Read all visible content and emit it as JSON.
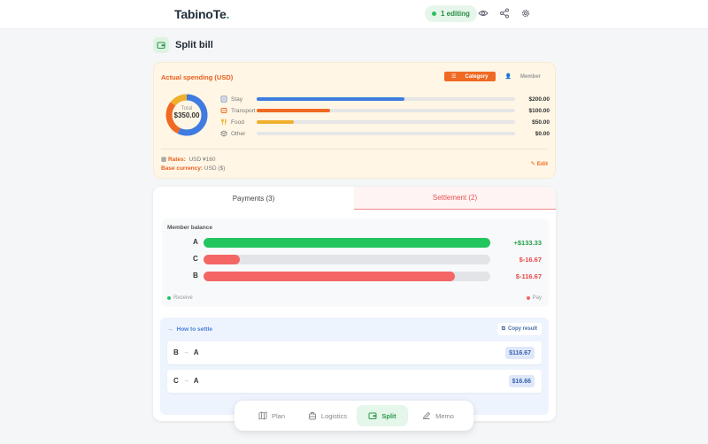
{
  "header": {
    "logo_main": "TabinoTe",
    "logo_dot": ".",
    "editing_label": "1 editing",
    "icons": [
      "eye-icon",
      "share-icon",
      "gear-icon"
    ]
  },
  "page": {
    "title": "Split bill"
  },
  "spending": {
    "title": "Actual spending (USD)",
    "toggle_category": "Category",
    "toggle_member": "Member",
    "total_label": "Total",
    "total_value": "$350.00",
    "categories": [
      {
        "name": "Stay",
        "amount": "$200.00",
        "value": 200,
        "color": "#3f7be0"
      },
      {
        "name": "Transport",
        "amount": "$100.00",
        "value": 100,
        "color": "#f06a24"
      },
      {
        "name": "Food",
        "amount": "$50.00",
        "value": 50,
        "color": "#f0b02c"
      },
      {
        "name": "Other",
        "amount": "$0.00",
        "value": 0,
        "color": "#bbbbbb"
      }
    ],
    "rates_label": "Rates:",
    "rates_value": "USD ¥160",
    "base_label": "Base currency:",
    "base_value": "USD ($)",
    "edit_label": "Edit"
  },
  "tabs": {
    "payments": "Payments (3)",
    "settlement": "Settlement (2)"
  },
  "balance": {
    "title": "Member balance",
    "members": [
      {
        "name": "A",
        "value": "+$133.33",
        "fill": 1.0,
        "color": "#22c55e",
        "text_color": "#22a04a"
      },
      {
        "name": "C",
        "value": "$-16.67",
        "fill": 0.125,
        "color": "#f46565",
        "text_color": "#e84848"
      },
      {
        "name": "B",
        "value": "$-116.67",
        "fill": 0.875,
        "color": "#f46565",
        "text_color": "#e84848"
      }
    ],
    "receive_label": "Receive",
    "pay_label": "Pay"
  },
  "settle": {
    "title": "How to settle",
    "copy_label": "Copy result",
    "rows": [
      {
        "from": "B",
        "to": "A",
        "amount": "$116.67"
      },
      {
        "from": "C",
        "to": "A",
        "amount": "$16.66"
      }
    ]
  },
  "nav": {
    "items": [
      {
        "label": "Plan",
        "icon": "map-icon"
      },
      {
        "label": "Logistics",
        "icon": "suitcase-icon"
      },
      {
        "label": "Split",
        "icon": "wallet-icon",
        "active": true
      },
      {
        "label": "Memo",
        "icon": "pencil-icon"
      }
    ]
  }
}
